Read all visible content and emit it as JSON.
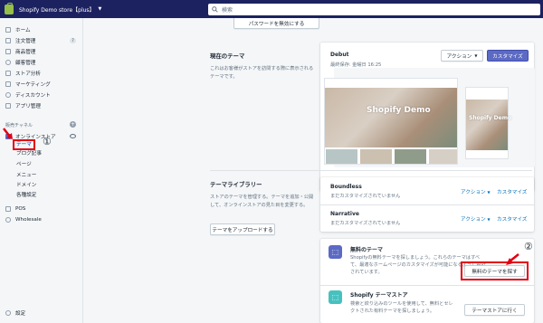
{
  "topbar": {
    "store_name": "Shopify Demo store【plus】",
    "search_placeholder": "検索"
  },
  "sidebar": {
    "items": [
      {
        "label": "ホーム"
      },
      {
        "label": "注文管理",
        "badge": "7"
      },
      {
        "label": "商品管理"
      },
      {
        "label": "顧客管理"
      },
      {
        "label": "ストア分析"
      },
      {
        "label": "マーケティング"
      },
      {
        "label": "ディスカウント"
      },
      {
        "label": "アプリ管理"
      }
    ],
    "section_label": "販売チャネル",
    "online_store": "オンラインストア",
    "sub_items": [
      "テーマ",
      "ブログ記事",
      "ページ",
      "メニュー",
      "ドメイン",
      "各種設定"
    ],
    "pos": "POS",
    "wholesale": "Wholesale",
    "settings": "設定"
  },
  "annotations": {
    "one": "①",
    "two": "②"
  },
  "top_button": "パスワードを無効にする",
  "current_theme": {
    "title": "現在のテーマ",
    "description": "これはお客様がストアを訪問する際に表示されるテーマです。",
    "name": "Debut",
    "saved": "最終保存: 金曜日 16:25",
    "action_label": "アクション",
    "customize_label": "カスタマイズ",
    "preview_title": "Shopify Demo",
    "preview_mobile_title": "Shopify Demo"
  },
  "library": {
    "title": "テーマライブラリー",
    "description": "ストアのテーマを管理する。テーマを追加・公開して、オンラインストアの見た目を変更する。",
    "upload_label": "テーマをアップロードする",
    "themes": [
      {
        "name": "Boundless",
        "status": "まだカスタマイズされていません",
        "action": "アクション",
        "customize": "カスタマイズ"
      },
      {
        "name": "Narrative",
        "status": "まだカスタマイズされていません",
        "action": "アクション",
        "customize": "カスタマイズ"
      }
    ]
  },
  "free_themes": {
    "title": "無料のテーマ",
    "description": "Shopifyの無料テーマを探しましょう。これらのテーマはすべて、最適なホームページのカスタマイズが可能になるように設計されています。",
    "button": "無料のテーマを探す"
  },
  "theme_store": {
    "title": "Shopify テーマストア",
    "description": "検索と絞り込みのツールを使用して、無料とセレクトされた有料テーマを探しましょう。",
    "button": "テーマストアに行く"
  },
  "colors": {
    "topbar": "#1c2260",
    "primary": "#5c6ac4",
    "highlight": "#e3000f",
    "link": "#006fbb"
  }
}
